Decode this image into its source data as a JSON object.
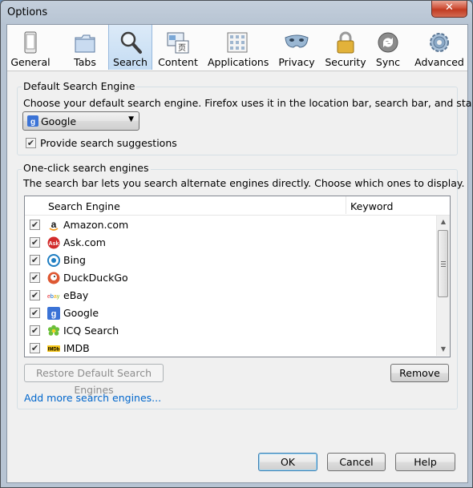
{
  "window": {
    "title": "Options",
    "close_glyph": "✕"
  },
  "toolbar": {
    "items": [
      {
        "label": "General",
        "icon": "general-icon"
      },
      {
        "label": "Tabs",
        "icon": "tabs-icon"
      },
      {
        "label": "Search",
        "icon": "search-icon",
        "selected": true
      },
      {
        "label": "Content",
        "icon": "content-icon"
      },
      {
        "label": "Applications",
        "icon": "applications-icon"
      },
      {
        "label": "Privacy",
        "icon": "privacy-icon"
      },
      {
        "label": "Security",
        "icon": "security-icon"
      },
      {
        "label": "Sync",
        "icon": "sync-icon"
      },
      {
        "label": "Advanced",
        "icon": "advanced-icon"
      }
    ]
  },
  "default_engine": {
    "group_title": "Default Search Engine",
    "description": "Choose your default search engine. Firefox uses it in the location bar, search bar, and start pages.",
    "selected": "Google",
    "suggestions_label": "Provide search suggestions",
    "suggestions_checked": true
  },
  "one_click": {
    "group_title": "One-click search engines",
    "description": "The search bar lets you search alternate engines directly. Choose which ones to display.",
    "columns": {
      "engine": "Search Engine",
      "keyword": "Keyword"
    },
    "engines": [
      {
        "name": "Amazon.com",
        "checked": true,
        "icon": "amazon-icon"
      },
      {
        "name": "Ask.com",
        "checked": true,
        "icon": "ask-icon"
      },
      {
        "name": "Bing",
        "checked": true,
        "icon": "bing-icon"
      },
      {
        "name": "DuckDuckGo",
        "checked": true,
        "icon": "duckduckgo-icon"
      },
      {
        "name": "eBay",
        "checked": true,
        "icon": "ebay-icon"
      },
      {
        "name": "Google",
        "checked": true,
        "icon": "google-icon"
      },
      {
        "name": "ICQ Search",
        "checked": true,
        "icon": "icq-icon"
      },
      {
        "name": "IMDB",
        "checked": true,
        "icon": "imdb-icon"
      }
    ],
    "restore_label": "Restore Default Search Engines",
    "remove_label": "Remove",
    "add_more_label": "Add more search engines..."
  },
  "footer": {
    "ok_label": "OK",
    "cancel_label": "Cancel",
    "help_label": "Help"
  },
  "check_glyph": "✔"
}
